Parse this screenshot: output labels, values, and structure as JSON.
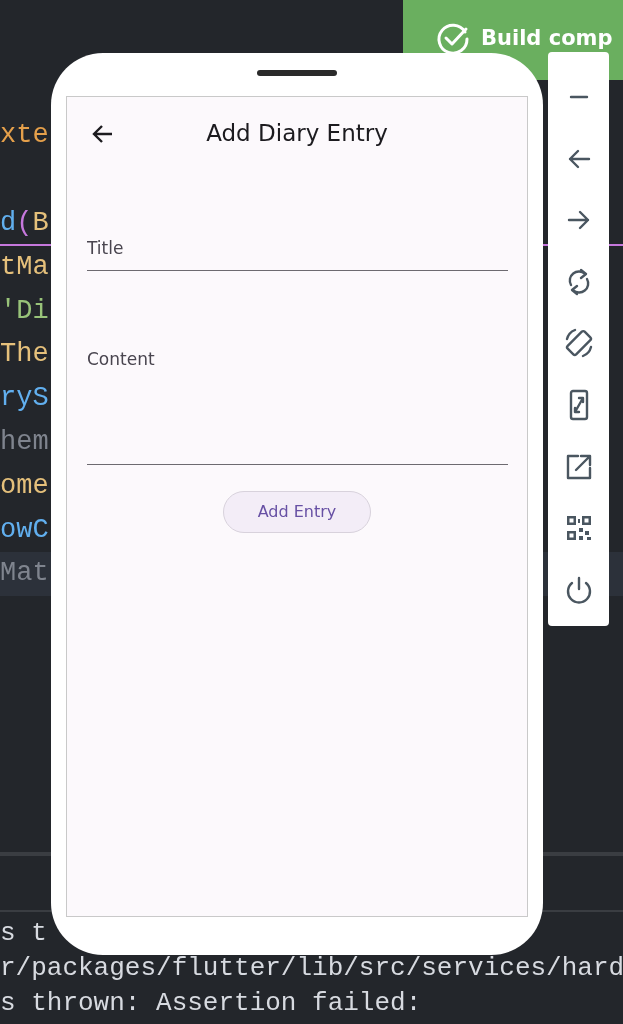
{
  "editor": {
    "lines": [
      {
        "kind": "blank"
      },
      {
        "kind": "blank"
      },
      {
        "kind": "blank"
      },
      {
        "kind": "code",
        "underlined": false,
        "highlighted": false,
        "segments": [
          {
            "text": "xte",
            "color": "#e5a04b"
          }
        ]
      },
      {
        "kind": "blank"
      },
      {
        "kind": "code",
        "underlined": true,
        "highlighted": false,
        "segments": [
          {
            "text": "d",
            "color": "#61afef"
          },
          {
            "text": "(",
            "color": "#c678dd"
          },
          {
            "text": "B",
            "color": "#e5c07b"
          }
        ]
      },
      {
        "kind": "code",
        "underlined": false,
        "highlighted": false,
        "segments": [
          {
            "text": "tMa",
            "color": "#e5c07b"
          }
        ]
      },
      {
        "kind": "code",
        "underlined": false,
        "highlighted": false,
        "segments": [
          {
            "text": "'Di",
            "color": "#98c379"
          }
        ]
      },
      {
        "kind": "code",
        "underlined": false,
        "highlighted": false,
        "segments": [
          {
            "text": "The",
            "color": "#e5c07b"
          }
        ]
      },
      {
        "kind": "code",
        "underlined": false,
        "highlighted": false,
        "segments": [
          {
            "text": "ryS",
            "color": "#61afef"
          }
        ]
      },
      {
        "kind": "code",
        "underlined": false,
        "highlighted": false,
        "segments": [
          {
            "text": "hem",
            "color": "#7f848e"
          }
        ]
      },
      {
        "kind": "code",
        "underlined": false,
        "highlighted": false,
        "segments": [
          {
            "text": "ome",
            "color": "#e5c07b"
          }
        ]
      },
      {
        "kind": "code",
        "underlined": false,
        "highlighted": false,
        "segments": [
          {
            "text": "owC",
            "color": "#61afef"
          }
        ]
      },
      {
        "kind": "code",
        "underlined": false,
        "highlighted": true,
        "segments": [
          {
            "text": "Mat",
            "color": "#7f848e"
          }
        ]
      }
    ]
  },
  "terminal": {
    "lines": [
      "s t",
      "r/packages/flutter/lib/src/services/hard",
      "s thrown: Assertion failed:"
    ]
  },
  "toast": {
    "text": "Build comp"
  },
  "phone": {
    "app_bar": {
      "title": "Add Diary Entry"
    },
    "fields": [
      {
        "kind": "single",
        "placeholder": "Title"
      },
      {
        "kind": "multi",
        "placeholder": "Content"
      }
    ],
    "button": "Add Entry"
  },
  "emulator_toolbar": {
    "buttons": [
      {
        "kind": "minimize"
      },
      {
        "kind": "back"
      },
      {
        "kind": "forward"
      },
      {
        "kind": "reload"
      },
      {
        "kind": "rotate"
      },
      {
        "kind": "resize"
      },
      {
        "kind": "open-external"
      },
      {
        "kind": "qr"
      },
      {
        "kind": "power"
      }
    ]
  }
}
